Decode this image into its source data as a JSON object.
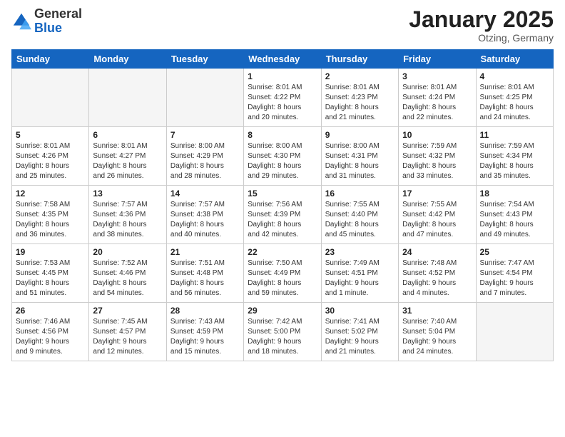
{
  "header": {
    "logo_general": "General",
    "logo_blue": "Blue",
    "month_title": "January 2025",
    "location": "Otzing, Germany"
  },
  "weekdays": [
    "Sunday",
    "Monday",
    "Tuesday",
    "Wednesday",
    "Thursday",
    "Friday",
    "Saturday"
  ],
  "weeks": [
    [
      {
        "day": "",
        "info": ""
      },
      {
        "day": "",
        "info": ""
      },
      {
        "day": "",
        "info": ""
      },
      {
        "day": "1",
        "info": "Sunrise: 8:01 AM\nSunset: 4:22 PM\nDaylight: 8 hours\nand 20 minutes."
      },
      {
        "day": "2",
        "info": "Sunrise: 8:01 AM\nSunset: 4:23 PM\nDaylight: 8 hours\nand 21 minutes."
      },
      {
        "day": "3",
        "info": "Sunrise: 8:01 AM\nSunset: 4:24 PM\nDaylight: 8 hours\nand 22 minutes."
      },
      {
        "day": "4",
        "info": "Sunrise: 8:01 AM\nSunset: 4:25 PM\nDaylight: 8 hours\nand 24 minutes."
      }
    ],
    [
      {
        "day": "5",
        "info": "Sunrise: 8:01 AM\nSunset: 4:26 PM\nDaylight: 8 hours\nand 25 minutes."
      },
      {
        "day": "6",
        "info": "Sunrise: 8:01 AM\nSunset: 4:27 PM\nDaylight: 8 hours\nand 26 minutes."
      },
      {
        "day": "7",
        "info": "Sunrise: 8:00 AM\nSunset: 4:29 PM\nDaylight: 8 hours\nand 28 minutes."
      },
      {
        "day": "8",
        "info": "Sunrise: 8:00 AM\nSunset: 4:30 PM\nDaylight: 8 hours\nand 29 minutes."
      },
      {
        "day": "9",
        "info": "Sunrise: 8:00 AM\nSunset: 4:31 PM\nDaylight: 8 hours\nand 31 minutes."
      },
      {
        "day": "10",
        "info": "Sunrise: 7:59 AM\nSunset: 4:32 PM\nDaylight: 8 hours\nand 33 minutes."
      },
      {
        "day": "11",
        "info": "Sunrise: 7:59 AM\nSunset: 4:34 PM\nDaylight: 8 hours\nand 35 minutes."
      }
    ],
    [
      {
        "day": "12",
        "info": "Sunrise: 7:58 AM\nSunset: 4:35 PM\nDaylight: 8 hours\nand 36 minutes."
      },
      {
        "day": "13",
        "info": "Sunrise: 7:57 AM\nSunset: 4:36 PM\nDaylight: 8 hours\nand 38 minutes."
      },
      {
        "day": "14",
        "info": "Sunrise: 7:57 AM\nSunset: 4:38 PM\nDaylight: 8 hours\nand 40 minutes."
      },
      {
        "day": "15",
        "info": "Sunrise: 7:56 AM\nSunset: 4:39 PM\nDaylight: 8 hours\nand 42 minutes."
      },
      {
        "day": "16",
        "info": "Sunrise: 7:55 AM\nSunset: 4:40 PM\nDaylight: 8 hours\nand 45 minutes."
      },
      {
        "day": "17",
        "info": "Sunrise: 7:55 AM\nSunset: 4:42 PM\nDaylight: 8 hours\nand 47 minutes."
      },
      {
        "day": "18",
        "info": "Sunrise: 7:54 AM\nSunset: 4:43 PM\nDaylight: 8 hours\nand 49 minutes."
      }
    ],
    [
      {
        "day": "19",
        "info": "Sunrise: 7:53 AM\nSunset: 4:45 PM\nDaylight: 8 hours\nand 51 minutes."
      },
      {
        "day": "20",
        "info": "Sunrise: 7:52 AM\nSunset: 4:46 PM\nDaylight: 8 hours\nand 54 minutes."
      },
      {
        "day": "21",
        "info": "Sunrise: 7:51 AM\nSunset: 4:48 PM\nDaylight: 8 hours\nand 56 minutes."
      },
      {
        "day": "22",
        "info": "Sunrise: 7:50 AM\nSunset: 4:49 PM\nDaylight: 8 hours\nand 59 minutes."
      },
      {
        "day": "23",
        "info": "Sunrise: 7:49 AM\nSunset: 4:51 PM\nDaylight: 9 hours\nand 1 minute."
      },
      {
        "day": "24",
        "info": "Sunrise: 7:48 AM\nSunset: 4:52 PM\nDaylight: 9 hours\nand 4 minutes."
      },
      {
        "day": "25",
        "info": "Sunrise: 7:47 AM\nSunset: 4:54 PM\nDaylight: 9 hours\nand 7 minutes."
      }
    ],
    [
      {
        "day": "26",
        "info": "Sunrise: 7:46 AM\nSunset: 4:56 PM\nDaylight: 9 hours\nand 9 minutes."
      },
      {
        "day": "27",
        "info": "Sunrise: 7:45 AM\nSunset: 4:57 PM\nDaylight: 9 hours\nand 12 minutes."
      },
      {
        "day": "28",
        "info": "Sunrise: 7:43 AM\nSunset: 4:59 PM\nDaylight: 9 hours\nand 15 minutes."
      },
      {
        "day": "29",
        "info": "Sunrise: 7:42 AM\nSunset: 5:00 PM\nDaylight: 9 hours\nand 18 minutes."
      },
      {
        "day": "30",
        "info": "Sunrise: 7:41 AM\nSunset: 5:02 PM\nDaylight: 9 hours\nand 21 minutes."
      },
      {
        "day": "31",
        "info": "Sunrise: 7:40 AM\nSunset: 5:04 PM\nDaylight: 9 hours\nand 24 minutes."
      },
      {
        "day": "",
        "info": ""
      }
    ]
  ]
}
